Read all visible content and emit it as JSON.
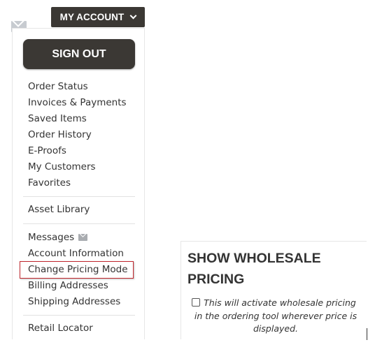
{
  "header": {
    "account_button_label": "MY ACCOUNT",
    "account_button_icon": "chevron-down-icon"
  },
  "dropdown": {
    "signout_label": "SIGN OUT",
    "groups": [
      [
        "Order Status",
        "Invoices & Payments",
        "Saved Items",
        "Order History",
        "E-Proofs",
        "My Customers",
        "Favorites"
      ],
      [
        "Asset Library"
      ],
      [
        "Messages",
        "Account Information",
        "Change Pricing Mode",
        "Billing Addresses",
        "Shipping Addresses"
      ],
      [
        "Retail Locator"
      ]
    ],
    "messages_icon": "envelope-icon",
    "highlighted_item": "Change Pricing Mode",
    "highlight_color": "#c0262d"
  },
  "pricing_panel": {
    "title": "SHOW WHOLESALE PRICING",
    "checkbox_checked": false,
    "checkbox_label": "This will activate wholesale pricing in the ordering tool wherever price is displayed."
  },
  "colors": {
    "button_bg": "#3b3834",
    "button_text": "#ffffff",
    "text": "#333333",
    "divider": "#e2e2e2"
  }
}
